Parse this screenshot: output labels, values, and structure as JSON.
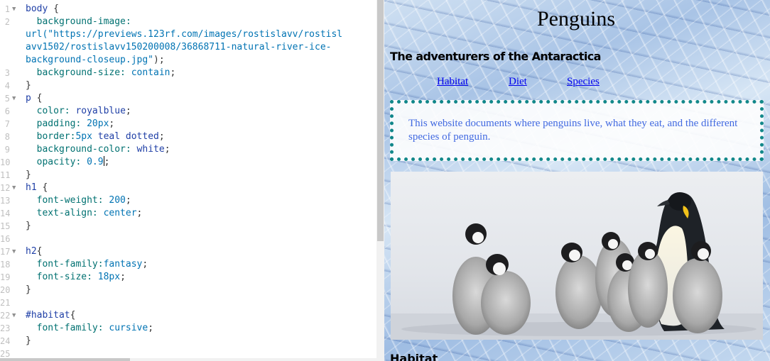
{
  "editor": {
    "lines": [
      {
        "num": "1",
        "fold": true,
        "parts": [
          [
            "sel",
            "body "
          ],
          [
            "punc",
            "{"
          ]
        ]
      },
      {
        "num": "2",
        "fold": false,
        "parts": [
          [
            "prop",
            "  background-image:"
          ]
        ]
      },
      {
        "num": "",
        "fold": false,
        "wrap": true,
        "parts": [
          [
            "val",
            "url(\"https://previews.123rf.com/images/rostislavv/rostisl"
          ]
        ]
      },
      {
        "num": "",
        "fold": false,
        "wrap": true,
        "parts": [
          [
            "val",
            "avv1502/rostislavv150200008/36868711-natural-river-ice-"
          ]
        ]
      },
      {
        "num": "",
        "fold": false,
        "wrap": true,
        "parts": [
          [
            "val",
            "background-closeup.jpg\""
          ],
          [
            "punc",
            ");"
          ]
        ]
      },
      {
        "num": "3",
        "fold": false,
        "parts": [
          [
            "prop",
            "  background-size: "
          ],
          [
            "val",
            "contain"
          ],
          [
            "punc",
            ";"
          ]
        ]
      },
      {
        "num": "4",
        "fold": false,
        "parts": [
          [
            "punc",
            "}"
          ]
        ]
      },
      {
        "num": "5",
        "fold": true,
        "parts": [
          [
            "sel",
            "p "
          ],
          [
            "punc",
            "{"
          ]
        ]
      },
      {
        "num": "6",
        "fold": false,
        "parts": [
          [
            "prop",
            "  color: "
          ],
          [
            "sel",
            "royalblue"
          ],
          [
            "punc",
            ";"
          ]
        ]
      },
      {
        "num": "7",
        "fold": false,
        "parts": [
          [
            "prop",
            "  padding: "
          ],
          [
            "val",
            "20px"
          ],
          [
            "punc",
            ";"
          ]
        ]
      },
      {
        "num": "8",
        "fold": false,
        "parts": [
          [
            "prop",
            "  border:"
          ],
          [
            "val",
            "5px "
          ],
          [
            "sel",
            "teal dotted"
          ],
          [
            "punc",
            ";"
          ]
        ]
      },
      {
        "num": "9",
        "fold": false,
        "parts": [
          [
            "prop",
            "  background-color: "
          ],
          [
            "sel",
            "white"
          ],
          [
            "punc",
            ";"
          ]
        ]
      },
      {
        "num": "10",
        "fold": false,
        "caret": true,
        "parts": [
          [
            "prop",
            "  opacity: "
          ],
          [
            "val",
            "0.9"
          ],
          [
            "caret",
            ""
          ],
          [
            "punc",
            ";"
          ]
        ]
      },
      {
        "num": "11",
        "fold": false,
        "parts": [
          [
            "punc",
            "}"
          ]
        ]
      },
      {
        "num": "12",
        "fold": true,
        "parts": [
          [
            "sel",
            "h1 "
          ],
          [
            "punc",
            "{"
          ]
        ]
      },
      {
        "num": "13",
        "fold": false,
        "parts": [
          [
            "prop",
            "  font-weight: "
          ],
          [
            "val",
            "200"
          ],
          [
            "punc",
            ";"
          ]
        ]
      },
      {
        "num": "14",
        "fold": false,
        "parts": [
          [
            "prop",
            "  text-align: "
          ],
          [
            "val",
            "center"
          ],
          [
            "punc",
            ";"
          ]
        ]
      },
      {
        "num": "15",
        "fold": false,
        "parts": [
          [
            "punc",
            "}"
          ]
        ]
      },
      {
        "num": "16",
        "fold": false,
        "parts": []
      },
      {
        "num": "17",
        "fold": true,
        "parts": [
          [
            "sel",
            "h2"
          ],
          [
            "punc",
            "{"
          ]
        ]
      },
      {
        "num": "18",
        "fold": false,
        "parts": [
          [
            "prop",
            "  font-family:"
          ],
          [
            "val",
            "fantasy"
          ],
          [
            "punc",
            ";"
          ]
        ]
      },
      {
        "num": "19",
        "fold": false,
        "parts": [
          [
            "prop",
            "  font-size: "
          ],
          [
            "val",
            "18px"
          ],
          [
            "punc",
            ";"
          ]
        ]
      },
      {
        "num": "20",
        "fold": false,
        "parts": [
          [
            "punc",
            "}"
          ]
        ]
      },
      {
        "num": "21",
        "fold": false,
        "parts": []
      },
      {
        "num": "22",
        "fold": true,
        "parts": [
          [
            "sel",
            "#habitat"
          ],
          [
            "punc",
            "{"
          ]
        ]
      },
      {
        "num": "23",
        "fold": false,
        "parts": [
          [
            "prop",
            "  font-family: "
          ],
          [
            "val",
            "cursive"
          ],
          [
            "punc",
            ";"
          ]
        ]
      },
      {
        "num": "24",
        "fold": false,
        "parts": [
          [
            "punc",
            "}"
          ]
        ]
      },
      {
        "num": "25",
        "fold": false,
        "parts": []
      }
    ]
  },
  "preview": {
    "title": "Penguins",
    "subtitle": "The adventurers of the Antaractica",
    "nav": {
      "habitat": "Habitat",
      "diet": "Diet",
      "species": "Species"
    },
    "intro": "This website documents where penguins live, what they eat, and the different species of penguin.",
    "next_heading": "Habitat"
  },
  "colors": {
    "selector": "#1f3fa6",
    "property": "#007171",
    "value": "#0073b3",
    "link": "#0000ee",
    "intro_text": "royalblue",
    "intro_border": "teal"
  }
}
